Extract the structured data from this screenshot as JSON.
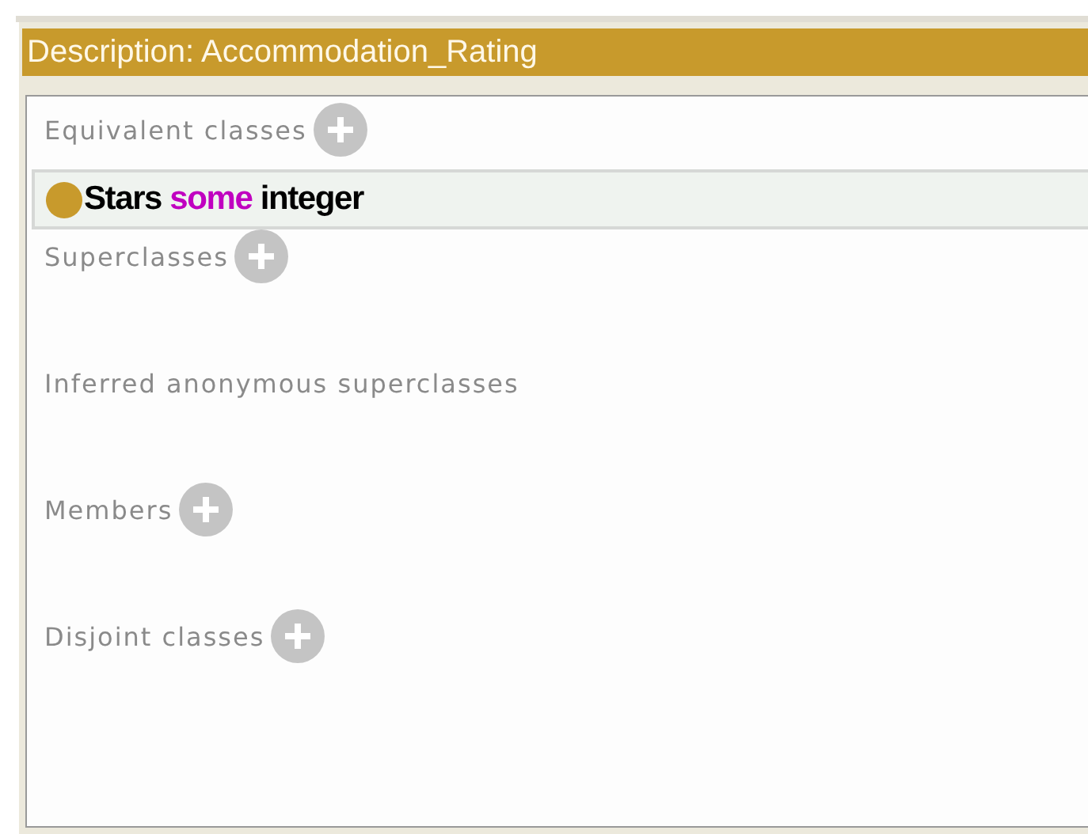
{
  "window": {
    "title": "Description: Accommodation_Rating"
  },
  "sections": [
    {
      "label": "Equivalent classes",
      "add_button": true,
      "items": [
        {
          "tokens": [
            {
              "text": "Stars",
              "kind": "entity"
            },
            {
              "text": "some",
              "kind": "keyword"
            },
            {
              "text": "integer",
              "kind": "entity"
            }
          ]
        }
      ]
    },
    {
      "label": "Superclasses",
      "add_button": true
    },
    {
      "label": "Inferred anonymous superclasses",
      "add_button": false
    },
    {
      "label": "Members",
      "add_button": true
    },
    {
      "label": "Disjoint classes",
      "add_button": true
    }
  ]
}
